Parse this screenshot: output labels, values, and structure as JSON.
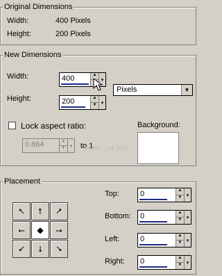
{
  "original": {
    "title": "Original Dimensions",
    "width_label": "Width:",
    "width_value": "400 Pixels",
    "height_label": "Height:",
    "height_value": "200 Pixels"
  },
  "new": {
    "title": "New Dimensions",
    "width_label": "Width:",
    "width_value": "400",
    "height_label": "Height:",
    "height_value": "200",
    "unit": "Pixels",
    "lock_label": "Lock aspect ratio:",
    "lock_checked": false,
    "ratio_value": "0.864",
    "to_label": "to 1",
    "background_label": "Background:"
  },
  "placement": {
    "title": "Placement",
    "top_label": "Top:",
    "top_value": "0",
    "bottom_label": "Bottom:",
    "bottom_value": "0",
    "left_label": "Left:",
    "left_value": "0",
    "right_label": "Right:",
    "right_value": "0"
  },
  "watermark": "timber_cut 2007",
  "icons": [
    "arrow-nw-icon",
    "arrow-n-icon",
    "arrow-ne-icon",
    "arrow-w-icon",
    "center-dot-icon",
    "arrow-e-icon",
    "arrow-sw-icon",
    "arrow-s-icon",
    "arrow-se-icon",
    "mouse-cursor-icon"
  ]
}
